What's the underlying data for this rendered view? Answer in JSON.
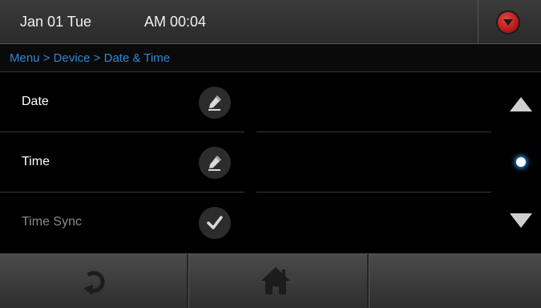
{
  "status_bar": {
    "date": "Jan 01 Tue",
    "time": "AM 00:04",
    "dropdown_icon": "chevron-down-icon",
    "dropdown_color": "#d42020"
  },
  "breadcrumb": {
    "items": [
      "Menu",
      "Device",
      "Date & Time"
    ],
    "separator": ">",
    "color": "#2f86d6"
  },
  "settings": [
    {
      "label": "Date",
      "action_icon": "pencil-icon",
      "enabled": true
    },
    {
      "label": "Time",
      "action_icon": "pencil-icon",
      "enabled": true
    },
    {
      "label": "Time Sync",
      "action_icon": "checkmark-icon",
      "enabled": false
    }
  ],
  "scroll": {
    "up_icon": "triangle-up-icon",
    "down_icon": "triangle-down-icon",
    "indicator_color": "#2a8fe0"
  },
  "bottom_bar": {
    "left_icon": "refresh-icon",
    "center_icon": "home-icon"
  }
}
